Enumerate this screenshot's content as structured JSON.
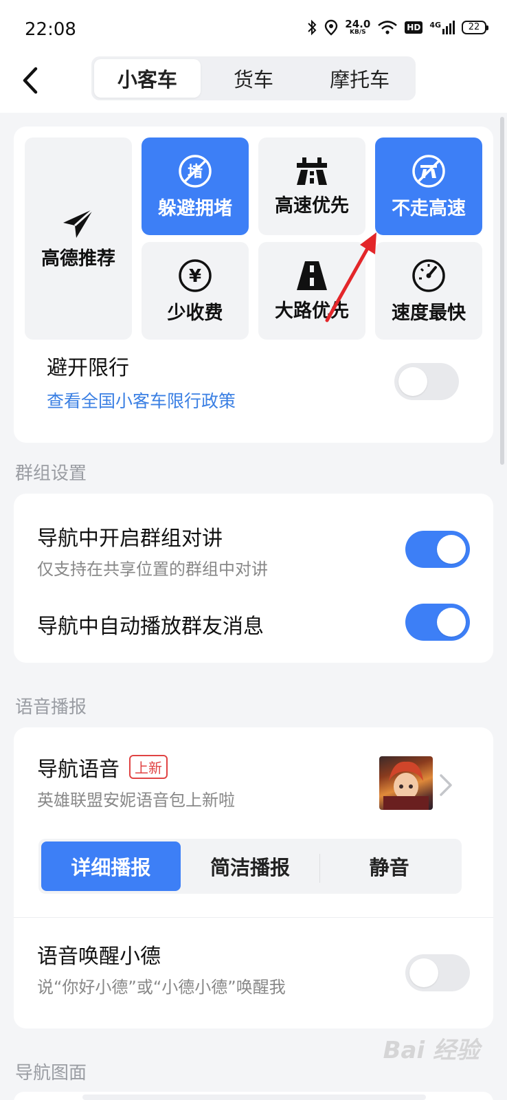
{
  "status": {
    "time": "22:08",
    "net_speed": "24.0",
    "net_unit": "KB/S",
    "hd": "HD",
    "signal": "4G",
    "battery": "22"
  },
  "vehicle_tabs": [
    "小客车",
    "货车",
    "摩托车"
  ],
  "route_prefs": {
    "recommend": "高德推荐",
    "avoid_congestion": "躲避拥堵",
    "highway_first": "高速优先",
    "no_highway": "不走高速",
    "less_toll": "少收费",
    "main_road_first": "大路优先",
    "fastest": "速度最快",
    "congestion_glyph": "堵",
    "yen_glyph": "¥"
  },
  "restriction": {
    "title": "避开限行",
    "link": "查看全国小客车限行政策"
  },
  "group_section": {
    "title": "群组设置",
    "intercom_title": "导航中开启群组对讲",
    "intercom_sub": "仅支持在共享位置的群组中对讲",
    "autoplay_title": "导航中自动播放群友消息"
  },
  "voice_section": {
    "title": "语音播报",
    "voice_title": "导航语音",
    "new_badge": "上新",
    "voice_sub": "英雄联盟安妮语音包上新啦",
    "modes": [
      "详细播报",
      "简洁播报",
      "静音"
    ],
    "wake_title": "语音唤醒小德",
    "wake_sub": "说“你好小德”或“小德小德”唤醒我"
  },
  "map_section": {
    "title": "导航图面"
  },
  "watermark": "Bai 经验",
  "colors": {
    "accent": "#3d7ff6",
    "badge_red": "#e04343",
    "link_blue": "#3a7fe3"
  }
}
